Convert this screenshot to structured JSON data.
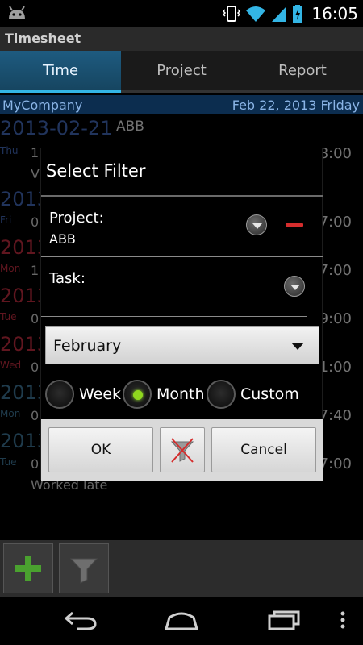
{
  "status_bar": {
    "clock": "16:05"
  },
  "app": {
    "title": "Timesheet"
  },
  "tabs": [
    {
      "label": "Time",
      "active": true
    },
    {
      "label": "Project",
      "active": false
    },
    {
      "label": "Report",
      "active": false
    }
  ],
  "company_bar": {
    "name": "MyCompany",
    "date": "Feb 22, 2013 Friday"
  },
  "entries": [
    {
      "date": "2013-02-21",
      "day": "Thu",
      "customer": "ABB",
      "hours": "10",
      "end_time": "8:00",
      "note": "V"
    },
    {
      "date": "2013",
      "day": "Fri",
      "hours": "08",
      "end_time": "7:00"
    },
    {
      "date": "2013",
      "day": "Mon",
      "hours": "10",
      "end_time": "7:00"
    },
    {
      "date": "2013",
      "day": "Tue",
      "hours": "09",
      "end_time": "9:00"
    },
    {
      "date": "2013",
      "day": "Wed",
      "hours": "08",
      "end_time": "1:00"
    },
    {
      "date": "2013",
      "day": "Mon",
      "hours": "09",
      "end_time": "7:40"
    },
    {
      "date": "2013",
      "day": "Tue",
      "hours": "0",
      "end_time": "7:00",
      "note": "Worked late"
    }
  ],
  "dialog": {
    "title": "Select Filter",
    "project_label": "Project:",
    "project_value": "ABB",
    "task_label": "Task:",
    "task_value": "",
    "period_value": "February",
    "radios": [
      {
        "label": "Week",
        "selected": false
      },
      {
        "label": "Month",
        "selected": true
      },
      {
        "label": "Custom",
        "selected": false
      }
    ],
    "ok_label": "OK",
    "cancel_label": "Cancel"
  },
  "toolbar": {
    "add_icon": "plus-icon",
    "filter_icon": "filter-icon"
  },
  "colors": {
    "accent": "#33b5e5",
    "company_bar": "#0c2d4f",
    "radio_on": "#8fd81e",
    "clear_red": "#d52d2d"
  }
}
